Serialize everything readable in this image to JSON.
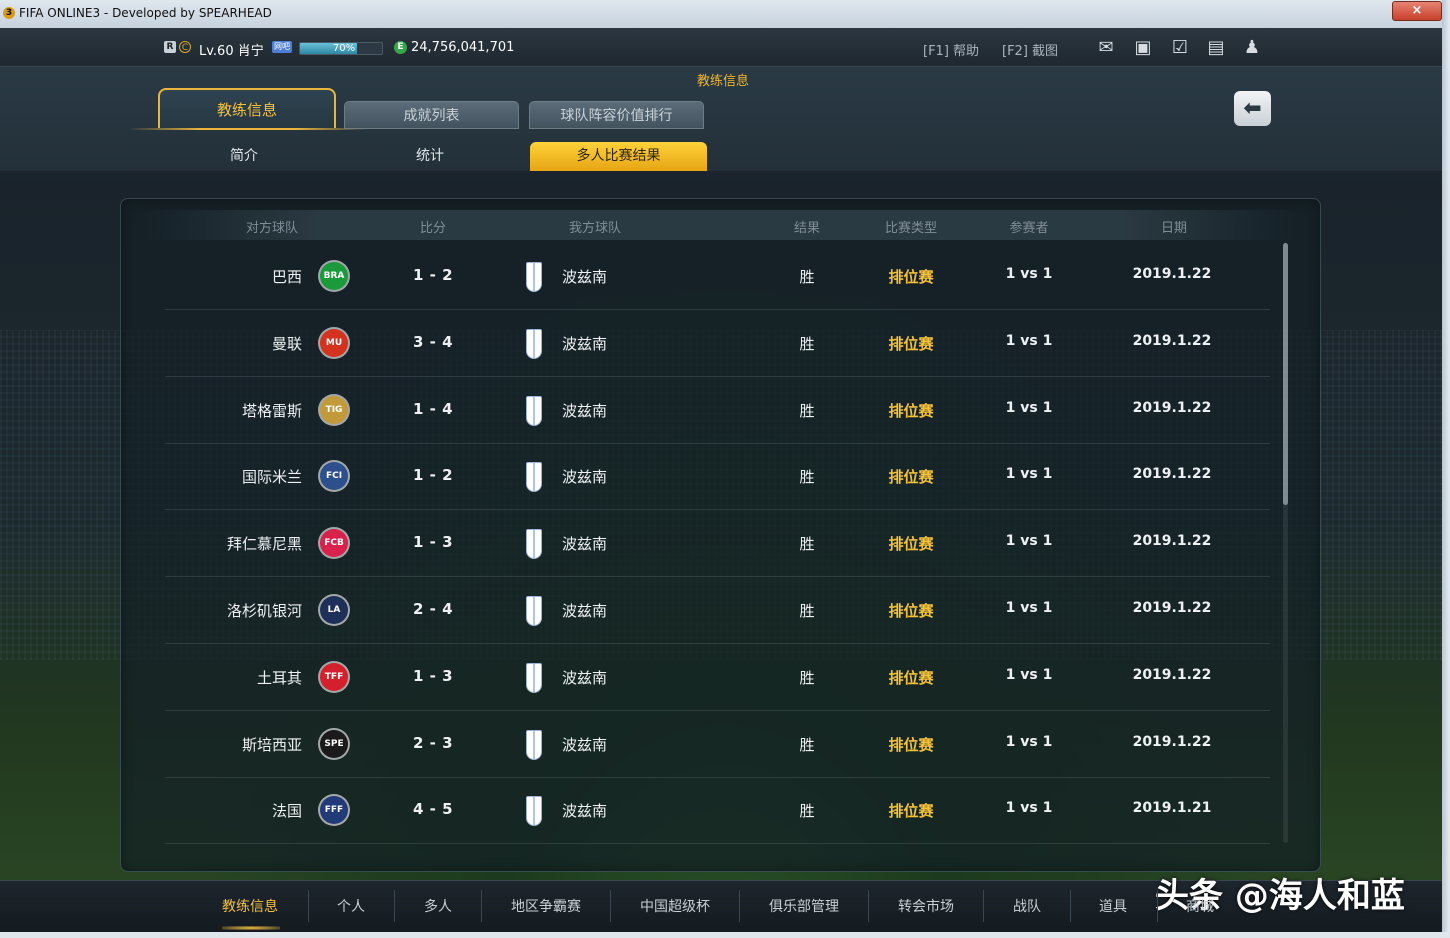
{
  "window": {
    "title": "FIFA ONLINE3 - Developed by SPEARHEAD",
    "close": "×",
    "app_icon": "3"
  },
  "topbar": {
    "badge_r": "R",
    "badge_c": "C",
    "level": "Lv.60 肖宁",
    "pc_tag": "网吧",
    "xp_percent": 70,
    "xp_label": "70%",
    "coin_icon": "E",
    "money": "24,756,041,701",
    "help": "[F1] 帮助",
    "capture": "[F2] 截图",
    "icons": [
      "mail-icon",
      "card-icon",
      "calendar-check-icon",
      "chat-icon",
      "person-icon"
    ]
  },
  "page_title": "教练信息",
  "tabs": [
    {
      "label": "教练信息",
      "active": true
    },
    {
      "label": "成就列表",
      "active": false
    },
    {
      "label": "球队阵容价值排行",
      "active": false
    }
  ],
  "back_button": "⬅",
  "subtabs": [
    {
      "label": "简介",
      "active": false
    },
    {
      "label": "统计",
      "active": false
    },
    {
      "label": "多人比赛结果",
      "active": true
    }
  ],
  "table": {
    "headers": [
      "对方球队",
      "比分",
      "我方球队",
      "结果",
      "比赛类型",
      "参赛者",
      "日期"
    ],
    "rows": [
      {
        "opponent": "巴西",
        "crest": "BRA",
        "crest_color": "#1b9a3b",
        "score": "1 - 2",
        "my_team": "波兹南",
        "result": "胜",
        "type": "排位赛",
        "players": "1 vs 1",
        "date": "2019.1.22"
      },
      {
        "opponent": "曼联",
        "crest": "MU",
        "crest_color": "#d2321e",
        "score": "3 - 4",
        "my_team": "波兹南",
        "result": "胜",
        "type": "排位赛",
        "players": "1 vs 1",
        "date": "2019.1.22"
      },
      {
        "opponent": "塔格雷斯",
        "crest": "TIG",
        "crest_color": "#c39a3a",
        "score": "1 - 4",
        "my_team": "波兹南",
        "result": "胜",
        "type": "排位赛",
        "players": "1 vs 1",
        "date": "2019.1.22"
      },
      {
        "opponent": "国际米兰",
        "crest": "FCI",
        "crest_color": "#2d4f8c",
        "score": "1 - 2",
        "my_team": "波兹南",
        "result": "胜",
        "type": "排位赛",
        "players": "1 vs 1",
        "date": "2019.1.22"
      },
      {
        "opponent": "拜仁慕尼黑",
        "crest": "FCB",
        "crest_color": "#d8214b",
        "score": "1 - 3",
        "my_team": "波兹南",
        "result": "胜",
        "type": "排位赛",
        "players": "1 vs 1",
        "date": "2019.1.22"
      },
      {
        "opponent": "洛杉矶银河",
        "crest": "LA",
        "crest_color": "#1e2f5a",
        "score": "2 - 4",
        "my_team": "波兹南",
        "result": "胜",
        "type": "排位赛",
        "players": "1 vs 1",
        "date": "2019.1.22"
      },
      {
        "opponent": "土耳其",
        "crest": "TFF",
        "crest_color": "#d4202c",
        "score": "1 - 3",
        "my_team": "波兹南",
        "result": "胜",
        "type": "排位赛",
        "players": "1 vs 1",
        "date": "2019.1.22"
      },
      {
        "opponent": "斯培西亚",
        "crest": "SPE",
        "crest_color": "#1a1a1a",
        "score": "2 - 3",
        "my_team": "波兹南",
        "result": "胜",
        "type": "排位赛",
        "players": "1 vs 1",
        "date": "2019.1.22"
      },
      {
        "opponent": "法国",
        "crest": "FFF",
        "crest_color": "#223a78",
        "score": "4 - 5",
        "my_team": "波兹南",
        "result": "胜",
        "type": "排位赛",
        "players": "1 vs 1",
        "date": "2019.1.21"
      }
    ]
  },
  "bottom_nav": [
    {
      "label": "教练信息",
      "active": true
    },
    {
      "label": "个人",
      "active": false
    },
    {
      "label": "多人",
      "active": false
    },
    {
      "label": "地区争霸赛",
      "active": false
    },
    {
      "label": "中国超级杯",
      "active": false
    },
    {
      "label": "俱乐部管理",
      "active": false
    },
    {
      "label": "转会市场",
      "active": false
    },
    {
      "label": "战队",
      "active": false
    },
    {
      "label": "道具",
      "active": false
    },
    {
      "label": "商城",
      "active": false
    }
  ],
  "watermark": "头条 @海人和蓝",
  "colors": {
    "accent": "#f4c040",
    "active_tab": "#ffd23a",
    "match_type": "#f4c23a"
  }
}
